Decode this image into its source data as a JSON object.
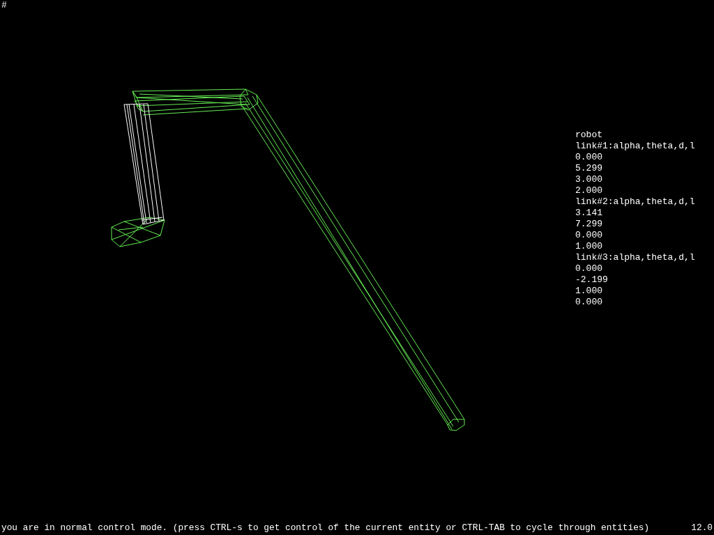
{
  "prompt": "#",
  "info_panel": {
    "title": "robot",
    "links": [
      {
        "header": "link#1:alpha,theta,d,l",
        "values": [
          "0.000",
          "5.299",
          "3.000",
          "2.000"
        ]
      },
      {
        "header": "link#2:alpha,theta,d,l",
        "values": [
          "3.141",
          "7.299",
          "0.000",
          "1.000"
        ]
      },
      {
        "header": "link#3:alpha,theta,d,l",
        "values": [
          "0.000",
          "-2.199",
          "1.000",
          "0.000"
        ]
      }
    ]
  },
  "status_bar": {
    "message": "you are in normal control mode. (press CTRL-s to get control of the current entity or CTRL-TAB to cycle through entities)",
    "value": "12.0"
  }
}
